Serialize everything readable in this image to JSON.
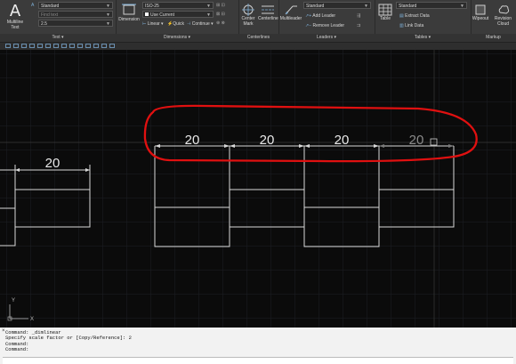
{
  "ribbon": {
    "text_panel": {
      "big_button": "Multiline Text",
      "style_value": "Standard",
      "layer_placeholder": "Find text",
      "height_value": "2.5",
      "panel_label": "Text"
    },
    "dimensions_panel": {
      "big_button": "Dimension",
      "style_value": "ISO-25",
      "use_current": "Use Current",
      "linear": "Linear",
      "quick": "Quick",
      "continue": "Continue",
      "panel_label": "Dimensions"
    },
    "centerlines_panel": {
      "center_mark": "Center Mark",
      "centerline": "Centerline",
      "panel_label": "Centerlines"
    },
    "leaders_panel": {
      "big_button": "Multileader",
      "style_value": "Standard",
      "add_leader": "Add Leader",
      "remove_leader": "Remove Leader",
      "panel_label": "Leaders"
    },
    "tables_panel": {
      "big_button": "Table",
      "style_value": "Standard",
      "extract_data": "Extract Data",
      "link_data": "Link Data",
      "panel_label": "Tables"
    },
    "markup_panel": {
      "wipeout": "Wipeout",
      "revision_cloud": "Revision Cloud",
      "panel_label": "Markup"
    }
  },
  "drawing": {
    "dimension_values": [
      "20",
      "20",
      "20",
      "20",
      "20"
    ],
    "ucs_y_label": "Y",
    "ucs_x_label": "X",
    "annotation_color": "#e01010"
  },
  "command_line": {
    "history": [
      "Command: _dimlinear",
      "Specify scale factor or [Copy/Reference]: 2",
      "Command:",
      "Command:"
    ],
    "close_glyph": "×",
    "prompt_placeholder": ""
  }
}
